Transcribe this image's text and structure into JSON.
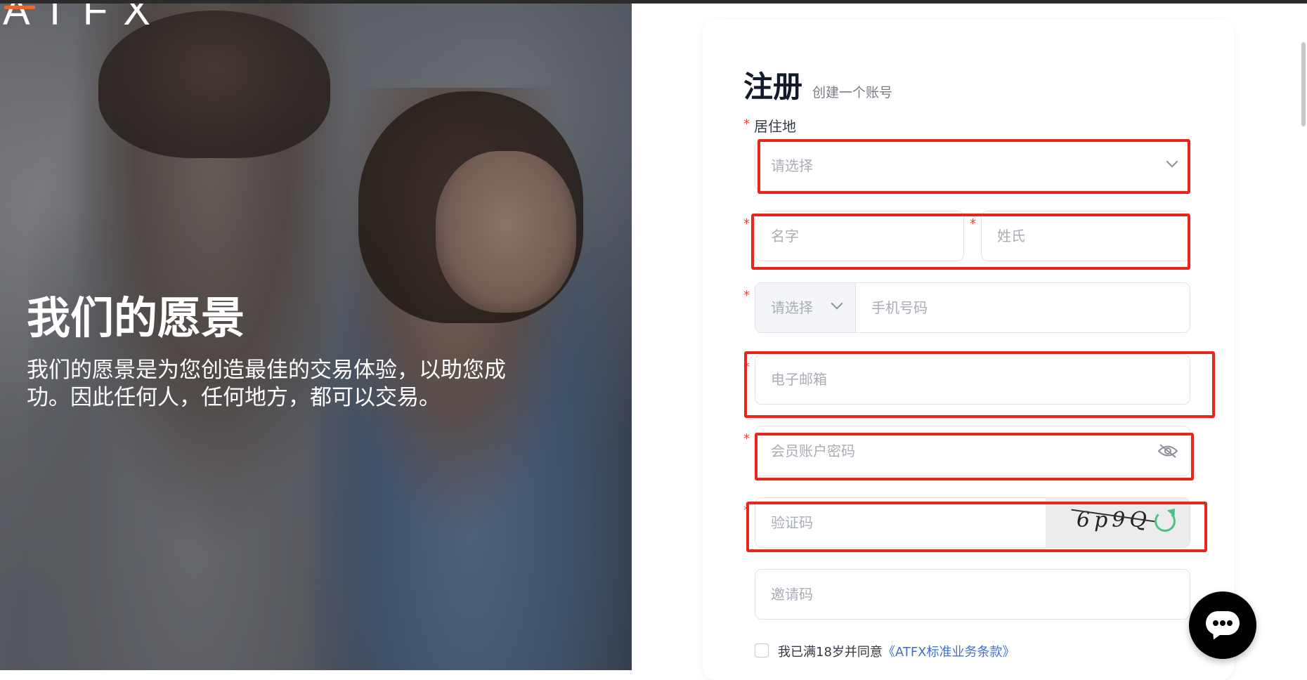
{
  "hero": {
    "logo": "ATFX",
    "title": "我们的愿景",
    "description": "我们的愿景是为您创造最佳的交易体验，以助您成功。因此任何人，任何地方，都可以交易。"
  },
  "form": {
    "title": "注册",
    "subtitle": "创建一个账号",
    "residence_label": "居住地",
    "required_mark": "*",
    "residence_placeholder": "请选择",
    "first_name_placeholder": "名字",
    "last_name_placeholder": "姓氏",
    "phone_code_placeholder": "请选择",
    "phone_placeholder": "手机号码",
    "email_placeholder": "电子邮箱",
    "password_placeholder": "会员账户密码",
    "captcha_placeholder": "验证码",
    "captcha_text": "6p9Q",
    "invite_placeholder": "邀请码",
    "agree_text": "我已满18岁并同意",
    "agree_link": "《ATFX标准业务条款》"
  },
  "icons": {
    "chat": "chat-bubble-icon",
    "refresh": "refresh-icon",
    "eye_off": "eye-off-icon",
    "chevron": "chevron-down-icon"
  },
  "colors": {
    "accent_link": "#3d6fd6",
    "required": "#e0493b",
    "annotation_box": "#e8261e",
    "refresh": "#4fbf8a"
  }
}
